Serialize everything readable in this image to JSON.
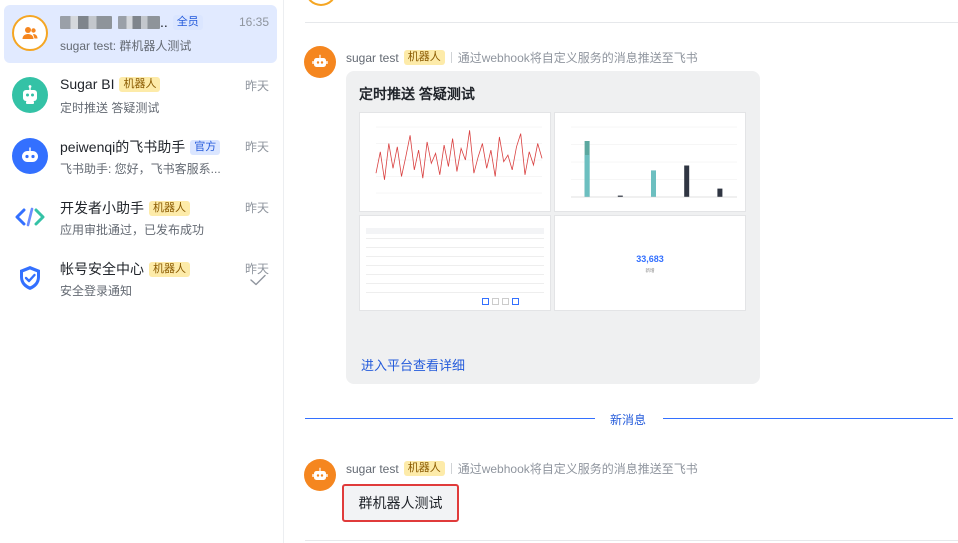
{
  "sidebar": {
    "chats": [
      {
        "title": "..",
        "tag": "全员",
        "subtitle": "sugar test: 群机器人测试",
        "time": "16:35"
      },
      {
        "title": "Sugar BI",
        "tag": "机器人",
        "subtitle": "定时推送 答疑测试",
        "time": "昨天"
      },
      {
        "title": "peiwenqi的飞书助手",
        "tag": "官方",
        "subtitle": "飞书助手: 您好，飞书客服系...",
        "time": "昨天"
      },
      {
        "title": "开发者小助手",
        "tag": "机器人",
        "subtitle": "应用审批通过，已发布成功",
        "time": "昨天"
      },
      {
        "title": "帐号安全中心",
        "tag": "机器人",
        "subtitle": "安全登录通知",
        "time": "昨天"
      }
    ]
  },
  "messages": [
    {
      "sender": "sugar test",
      "tag": "机器人",
      "note": "通过webhook将自定义服务的消息推送至飞书"
    },
    {
      "sender": "sugar test",
      "tag": "机器人",
      "note": "通过webhook将自定义服务的消息推送至飞书"
    }
  ],
  "card": {
    "title": "定时推送 答疑测试",
    "link": "进入平台查看详细",
    "kpi_value": "33,683",
    "kpi_label": "新增"
  },
  "divider_label": "新消息",
  "bubble_text": "群机器人测试",
  "colors": {
    "accent": "#3370ff",
    "bot_orange": "#f5861f",
    "highlight": "#e03b3b"
  },
  "chart_data": [
    {
      "type": "line",
      "series": [
        {
          "values": [
            12,
            25,
            8,
            30,
            15,
            28,
            10,
            22,
            35,
            14,
            26,
            9,
            31,
            18,
            24,
            11,
            29,
            16,
            33,
            13,
            27,
            20,
            38,
            12,
            22,
            30,
            15,
            26,
            10,
            34,
            19,
            23,
            14,
            28,
            36,
            11,
            25,
            17,
            30,
            21
          ]
        }
      ],
      "ylim": [
        0,
        40
      ]
    },
    {
      "type": "bar",
      "categories": [
        "",
        "",
        "",
        "",
        ""
      ],
      "series": [
        {
          "values": [
            80,
            0,
            0,
            0,
            0
          ]
        },
        {
          "values": [
            0,
            2,
            0,
            45,
            12
          ]
        },
        {
          "values": [
            60,
            0,
            38,
            0,
            0
          ]
        }
      ],
      "ylim": [
        0,
        100
      ]
    }
  ]
}
